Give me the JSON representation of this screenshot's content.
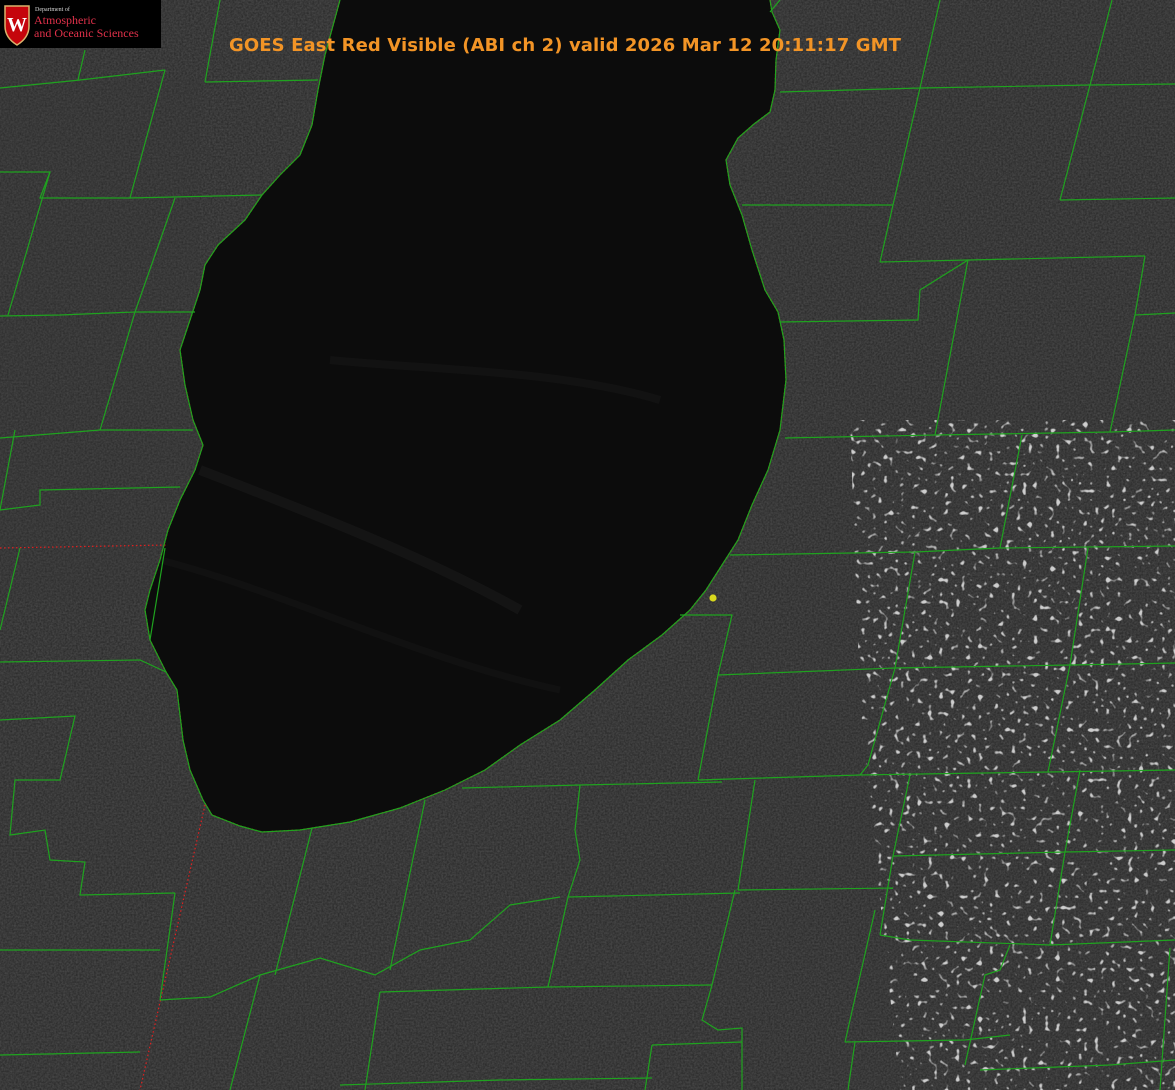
{
  "title": {
    "text": "GOES East Red Visible (ABI ch 2) valid 2026 Mar 12 20:11:17 GMT",
    "color": "#f29426"
  },
  "logo": {
    "department_label": "Department of",
    "name_line1": "Atmospheric",
    "name_line2": "and Oceanic Sciences",
    "crest_letter": "W",
    "crest_color": "#c5050c",
    "text_color": "#e0314a"
  },
  "map": {
    "lake": "dark water body",
    "county_line_color": "#1fa31f",
    "coastline_color": "#e02020",
    "land_tone": "#252525",
    "water_tone": "#0c0c0c",
    "marker_color": "#d8d81e"
  }
}
